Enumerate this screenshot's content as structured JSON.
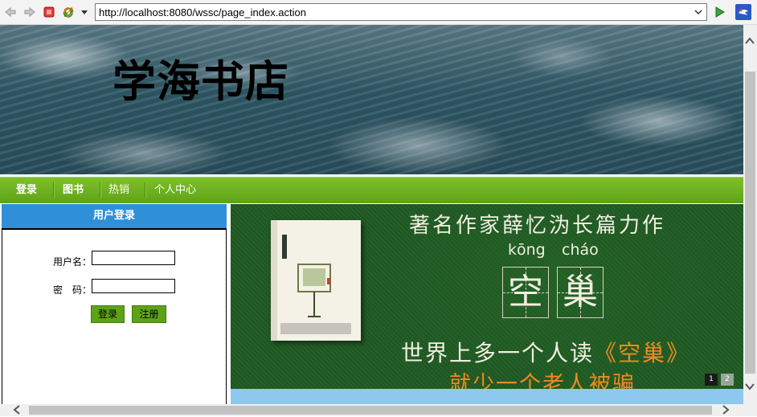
{
  "browser": {
    "url": "http://localhost:8080/wssc/page_index.action"
  },
  "site": {
    "title": "学海书店"
  },
  "nav": {
    "items": [
      "登录",
      "图书",
      "热销",
      "个人中心"
    ]
  },
  "login": {
    "header": "用户登录",
    "username_label": "用户名：",
    "password_label": "密　码：",
    "username_value": "",
    "password_value": "",
    "login_button": "登录",
    "register_button": "注册"
  },
  "ad": {
    "top_text": "著名作家薛忆沩长篇力作",
    "pinyin_1": "kōng",
    "pinyin_2": "cháo",
    "glyph_1": "空",
    "glyph_2": "巢",
    "line1_main": "世界上多一个人读",
    "line1_highlight": "《空巢》",
    "line2": "就少一个老人被骗",
    "pager": [
      "1",
      "2"
    ]
  }
}
